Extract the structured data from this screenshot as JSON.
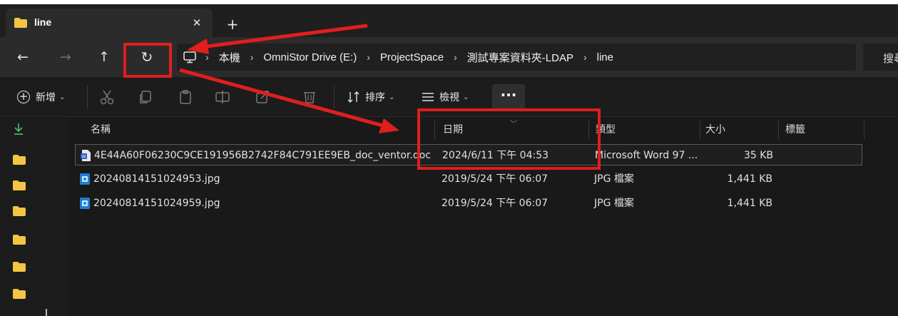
{
  "tab": {
    "title": "line",
    "close_label": "✕",
    "new_tab_label": "+"
  },
  "nav": {
    "back": "←",
    "forward": "→",
    "up": "↑",
    "refresh": "↻"
  },
  "breadcrumb": {
    "separator": "›",
    "items": [
      "本機",
      "OmniStor Drive (E:)",
      "ProjectSpace",
      "測試專案資料夾-LDAP",
      "line"
    ]
  },
  "search": {
    "label": "搜尋"
  },
  "toolbar": {
    "new_label": "新增",
    "sort_label": "排序",
    "view_label": "檢視",
    "more_label": "···"
  },
  "columns": {
    "name": "名稱",
    "date": "日期",
    "type": "類型",
    "size": "大小",
    "tags": "標籤"
  },
  "files": [
    {
      "name": "4E44A60F06230C9CE191956B2742F84C791EE9EB_doc_ventor.doc",
      "date": "2024/6/11 下午 04:53",
      "type": "Microsoft Word 97 ...",
      "size": "35 KB",
      "icon": "word-doc-icon"
    },
    {
      "name": "20240814151024953.jpg",
      "date": "2019/5/24 下午 06:07",
      "type": "JPG 檔案",
      "size": "1,441 KB",
      "icon": "image-file-icon"
    },
    {
      "name": "20240814151024959.jpg",
      "date": "2019/5/24 下午 06:07",
      "type": "JPG 檔案",
      "size": "1,441 KB",
      "icon": "image-file-icon"
    }
  ],
  "colors": {
    "annotation": "#e01e1e",
    "folder": "#f2c543",
    "accent": "#4fc65a"
  }
}
